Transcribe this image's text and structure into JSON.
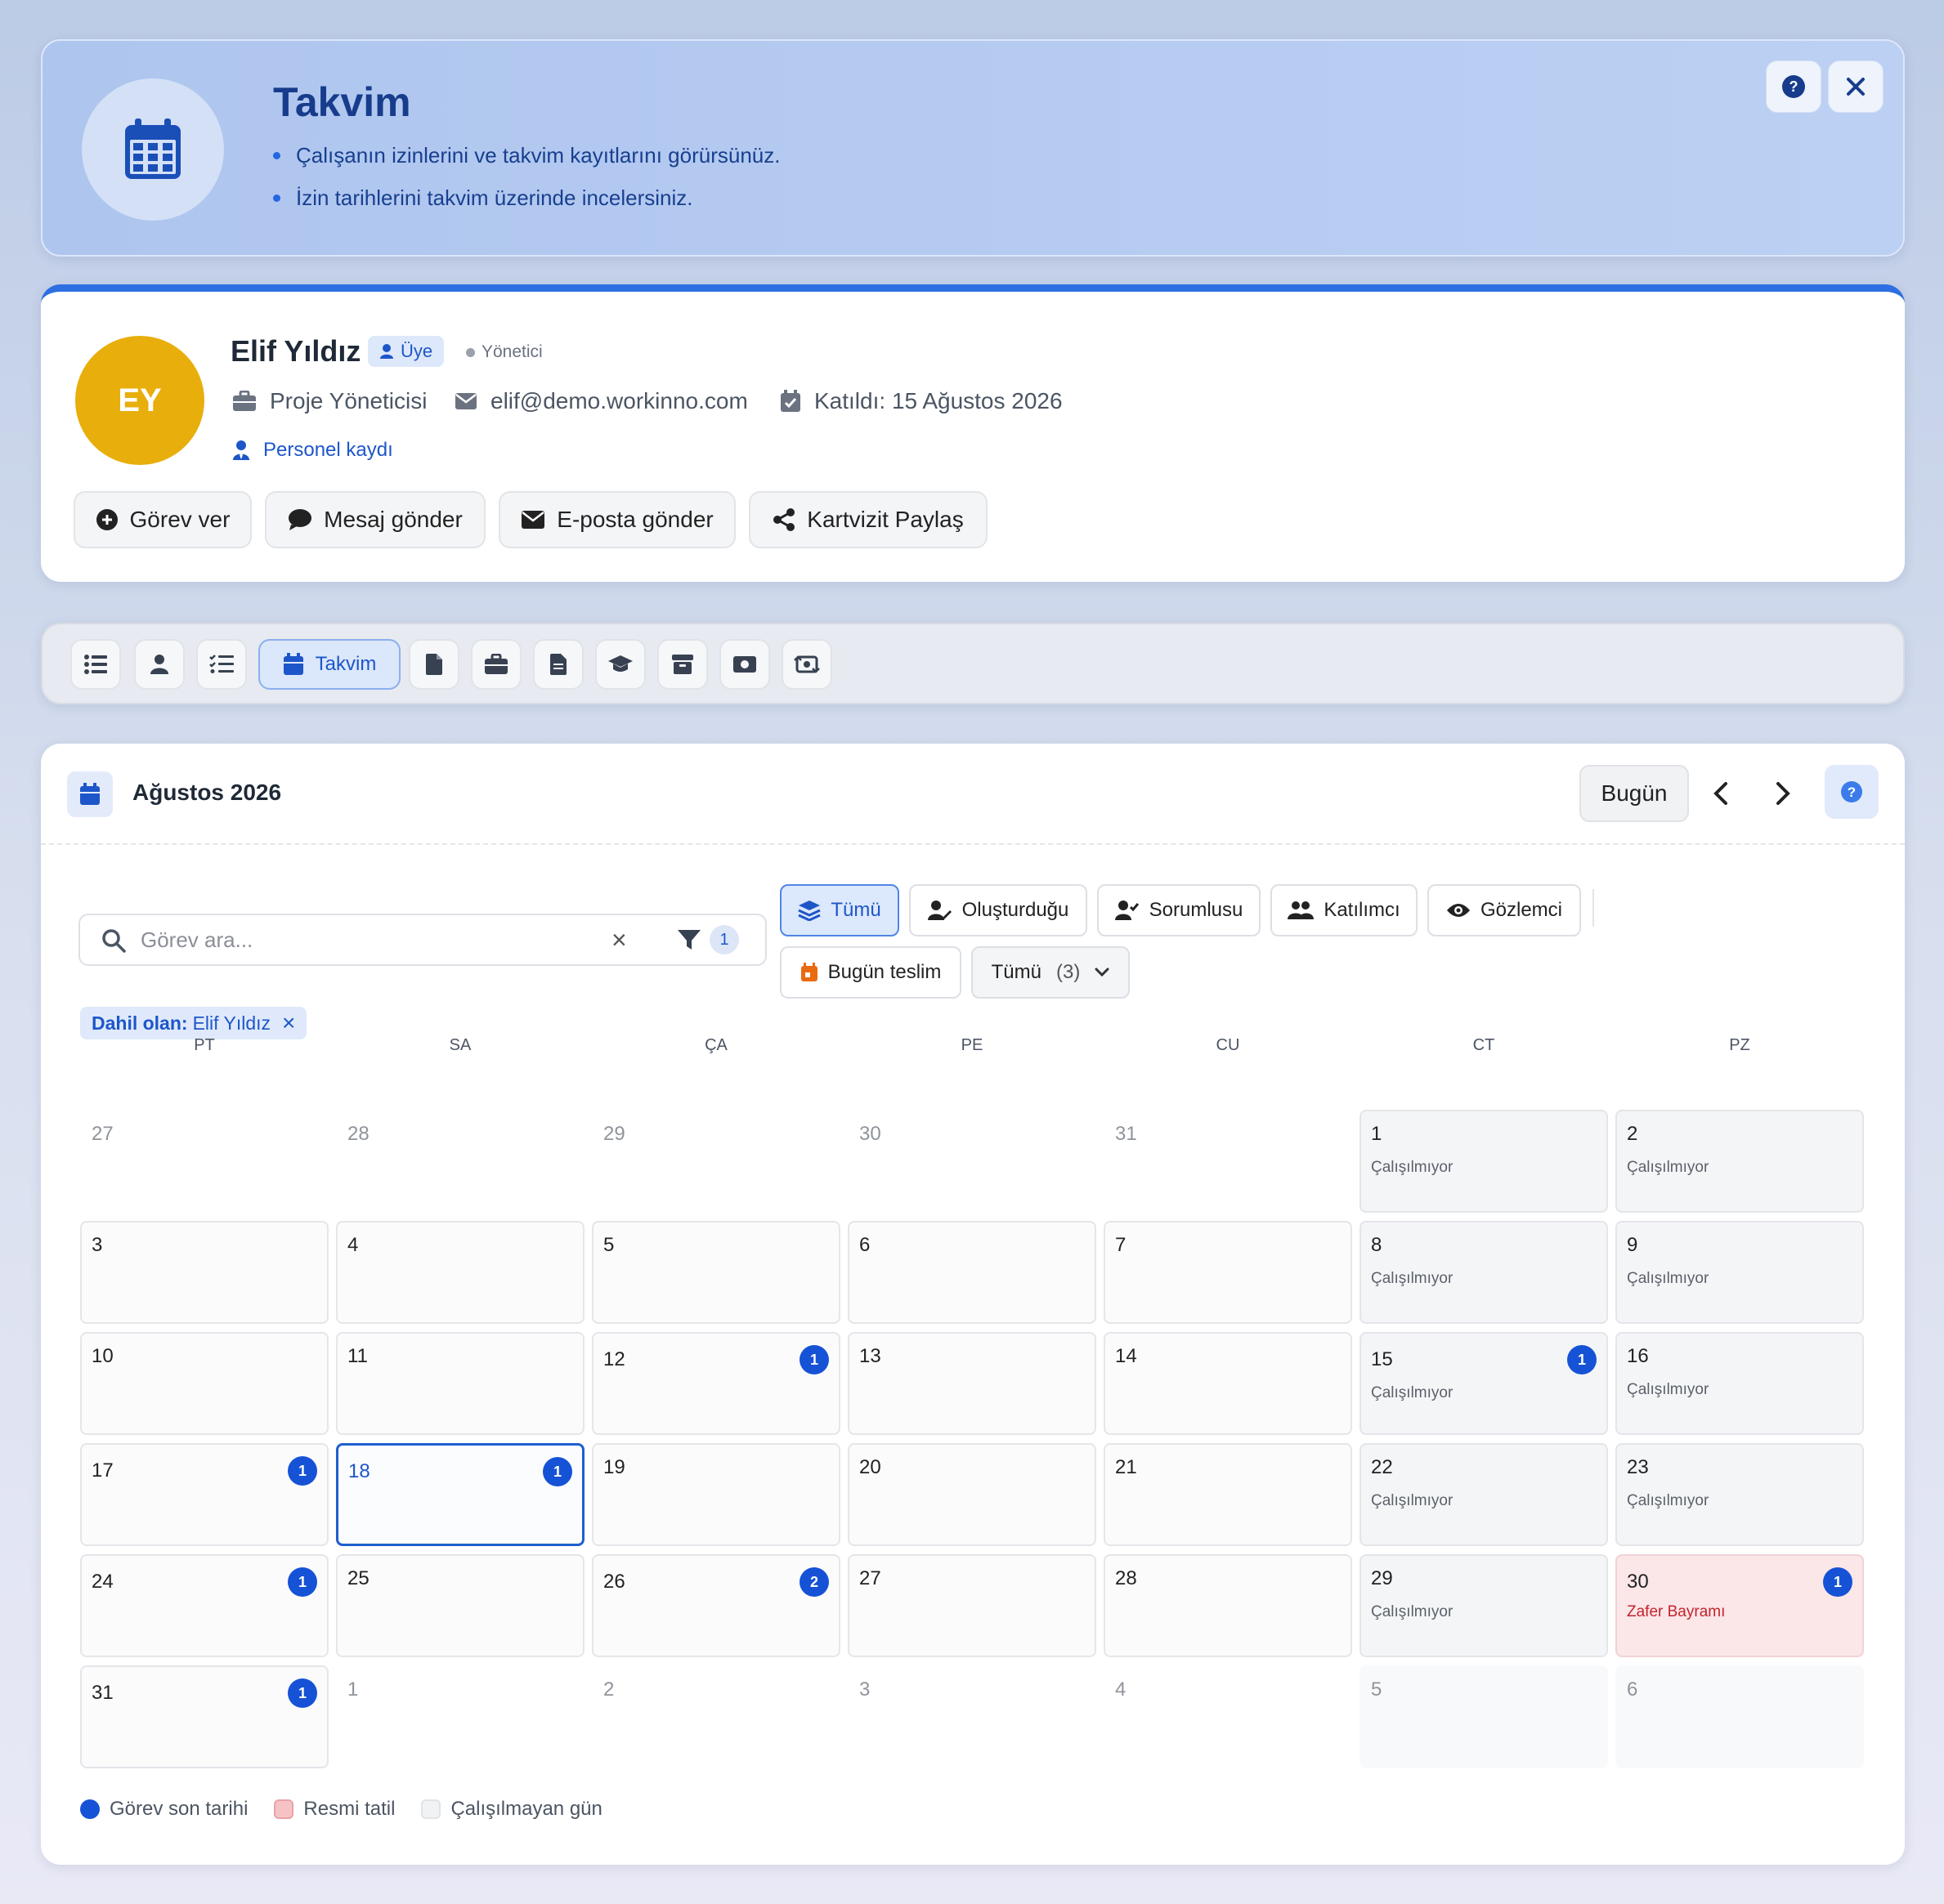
{
  "header": {
    "title": "Takvim",
    "bullets": [
      "Çalışanın izinlerini ve takvim kayıtlarını görürsünüz.",
      "İzin tarihlerini takvim üzerinde incelersiniz."
    ],
    "help_icon": "question-circle-icon",
    "close_icon": "close-icon"
  },
  "profile": {
    "initials": "EY",
    "name": "Elif Yıldız",
    "role_badge": "Üye",
    "status_label": "Yönetici",
    "job_title": "Proje Yöneticisi",
    "email": "elif@demo.workinno.com",
    "joined": "Katıldı: 15 Ağustos 2026",
    "record_link": "Personel kaydı",
    "avatar_color": "#e8ae0b",
    "actions": {
      "assign": "Görev ver",
      "message": "Mesaj gönder",
      "email": "E-posta gönder",
      "share": "Kartvizit Paylaş"
    }
  },
  "tabs": {
    "active_label": "Takvim",
    "icons": [
      "list-icon",
      "user-icon",
      "checklist-icon",
      "calendar-icon",
      "file-icon",
      "briefcase-icon",
      "document-icon",
      "graduation-cap-icon",
      "archive-icon",
      "money-icon",
      "money-transfer-icon"
    ]
  },
  "calendar": {
    "month_title": "Ağustos 2026",
    "today_label": "Bugün",
    "search_placeholder": "Görev ara...",
    "filter_count": "1",
    "filters": {
      "all": "Tümü",
      "created": "Oluşturduğu",
      "responsible": "Sorumlusu",
      "participant": "Katılımcı",
      "observer": "Gözlemci",
      "due_today": "Bugün teslim",
      "dropdown": "Tümü",
      "dropdown_count": "(3)"
    },
    "tag": {
      "label": "Dahil olan:",
      "value": "Elif Yıldız"
    },
    "weekdays": [
      "PT",
      "SA",
      "ÇA",
      "PE",
      "CU",
      "CT",
      "PZ"
    ],
    "off_label": "Çalışılmıyor",
    "holiday_label": "Zafer Bayramı",
    "days": [
      {
        "n": "27",
        "s": "outside"
      },
      {
        "n": "28",
        "s": "outside"
      },
      {
        "n": "29",
        "s": "outside"
      },
      {
        "n": "30",
        "s": "outside"
      },
      {
        "n": "31",
        "s": "outside"
      },
      {
        "n": "1",
        "s": "off"
      },
      {
        "n": "2",
        "s": "off"
      },
      {
        "n": "3",
        "s": "normal"
      },
      {
        "n": "4",
        "s": "normal"
      },
      {
        "n": "5",
        "s": "normal"
      },
      {
        "n": "6",
        "s": "normal"
      },
      {
        "n": "7",
        "s": "normal"
      },
      {
        "n": "8",
        "s": "off"
      },
      {
        "n": "9",
        "s": "off"
      },
      {
        "n": "10",
        "s": "normal"
      },
      {
        "n": "11",
        "s": "normal"
      },
      {
        "n": "12",
        "s": "normal",
        "b": "1"
      },
      {
        "n": "13",
        "s": "normal"
      },
      {
        "n": "14",
        "s": "normal"
      },
      {
        "n": "15",
        "s": "off",
        "b": "1"
      },
      {
        "n": "16",
        "s": "off"
      },
      {
        "n": "17",
        "s": "normal",
        "b": "1"
      },
      {
        "n": "18",
        "s": "today",
        "b": "1"
      },
      {
        "n": "19",
        "s": "normal"
      },
      {
        "n": "20",
        "s": "normal"
      },
      {
        "n": "21",
        "s": "normal"
      },
      {
        "n": "22",
        "s": "off"
      },
      {
        "n": "23",
        "s": "off"
      },
      {
        "n": "24",
        "s": "normal",
        "b": "1"
      },
      {
        "n": "25",
        "s": "normal"
      },
      {
        "n": "26",
        "s": "normal",
        "b": "2"
      },
      {
        "n": "27",
        "s": "normal"
      },
      {
        "n": "28",
        "s": "normal"
      },
      {
        "n": "29",
        "s": "off"
      },
      {
        "n": "30",
        "s": "holiday",
        "b": "1"
      },
      {
        "n": "31",
        "s": "normal",
        "b": "1"
      },
      {
        "n": "1",
        "s": "outside"
      },
      {
        "n": "2",
        "s": "outside"
      },
      {
        "n": "3",
        "s": "outside"
      },
      {
        "n": "4",
        "s": "outside"
      },
      {
        "n": "5",
        "s": "outside-off"
      },
      {
        "n": "6",
        "s": "outside-off"
      }
    ],
    "legend": {
      "due": "Görev son tarihi",
      "holiday": "Resmi tatil",
      "off": "Çalışılmayan gün"
    },
    "colors": {
      "accent": "#1552d6",
      "holiday": "#f6c3c5",
      "off": "#f1f2f4"
    }
  }
}
